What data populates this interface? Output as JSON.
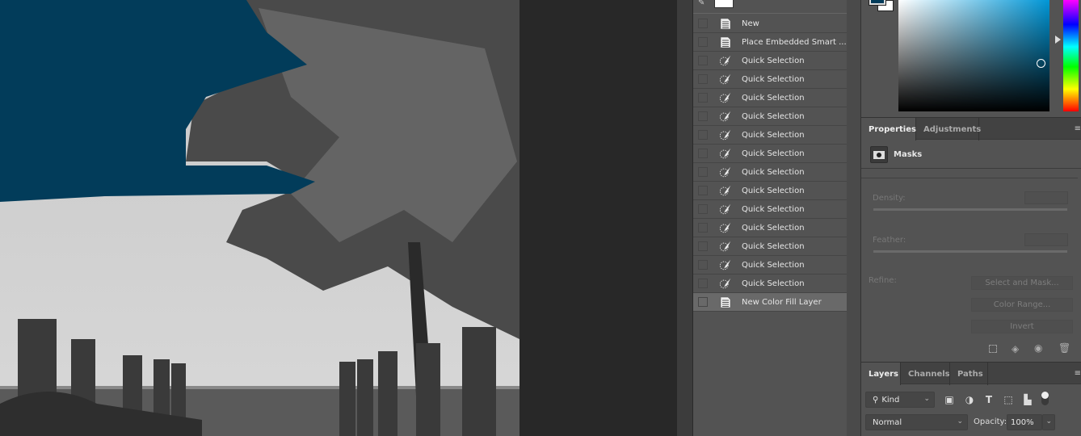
{
  "colors": {
    "fill_color": "#023c5a",
    "panel_bg": "#535353",
    "selected_row": "#696969"
  },
  "history": {
    "items": [
      {
        "label": "New",
        "icon": "document-icon"
      },
      {
        "label": "Place Embedded Smart ...",
        "icon": "document-icon"
      },
      {
        "label": "Quick Selection",
        "icon": "quick-selection-icon"
      },
      {
        "label": "Quick Selection",
        "icon": "quick-selection-icon"
      },
      {
        "label": "Quick Selection",
        "icon": "quick-selection-icon"
      },
      {
        "label": "Quick Selection",
        "icon": "quick-selection-icon"
      },
      {
        "label": "Quick Selection",
        "icon": "quick-selection-icon"
      },
      {
        "label": "Quick Selection",
        "icon": "quick-selection-icon"
      },
      {
        "label": "Quick Selection",
        "icon": "quick-selection-icon"
      },
      {
        "label": "Quick Selection",
        "icon": "quick-selection-icon"
      },
      {
        "label": "Quick Selection",
        "icon": "quick-selection-icon"
      },
      {
        "label": "Quick Selection",
        "icon": "quick-selection-icon"
      },
      {
        "label": "Quick Selection",
        "icon": "quick-selection-icon"
      },
      {
        "label": "Quick Selection",
        "icon": "quick-selection-icon"
      },
      {
        "label": "Quick Selection",
        "icon": "quick-selection-icon"
      },
      {
        "label": "New Color Fill Layer",
        "icon": "document-icon",
        "selected": true
      }
    ]
  },
  "properties": {
    "tabs": [
      "Properties",
      "Adjustments"
    ],
    "section": "Masks",
    "density_label": "Density:",
    "feather_label": "Feather:",
    "refine_label": "Refine:",
    "select_mask": "Select and Mask...",
    "color_range": "Color Range...",
    "invert": "Invert"
  },
  "layers": {
    "tabs": [
      "Layers",
      "Channels",
      "Paths"
    ],
    "filter": "Kind",
    "blend_mode": "Normal",
    "opacity_label": "Opacity:",
    "opacity": "100%"
  }
}
